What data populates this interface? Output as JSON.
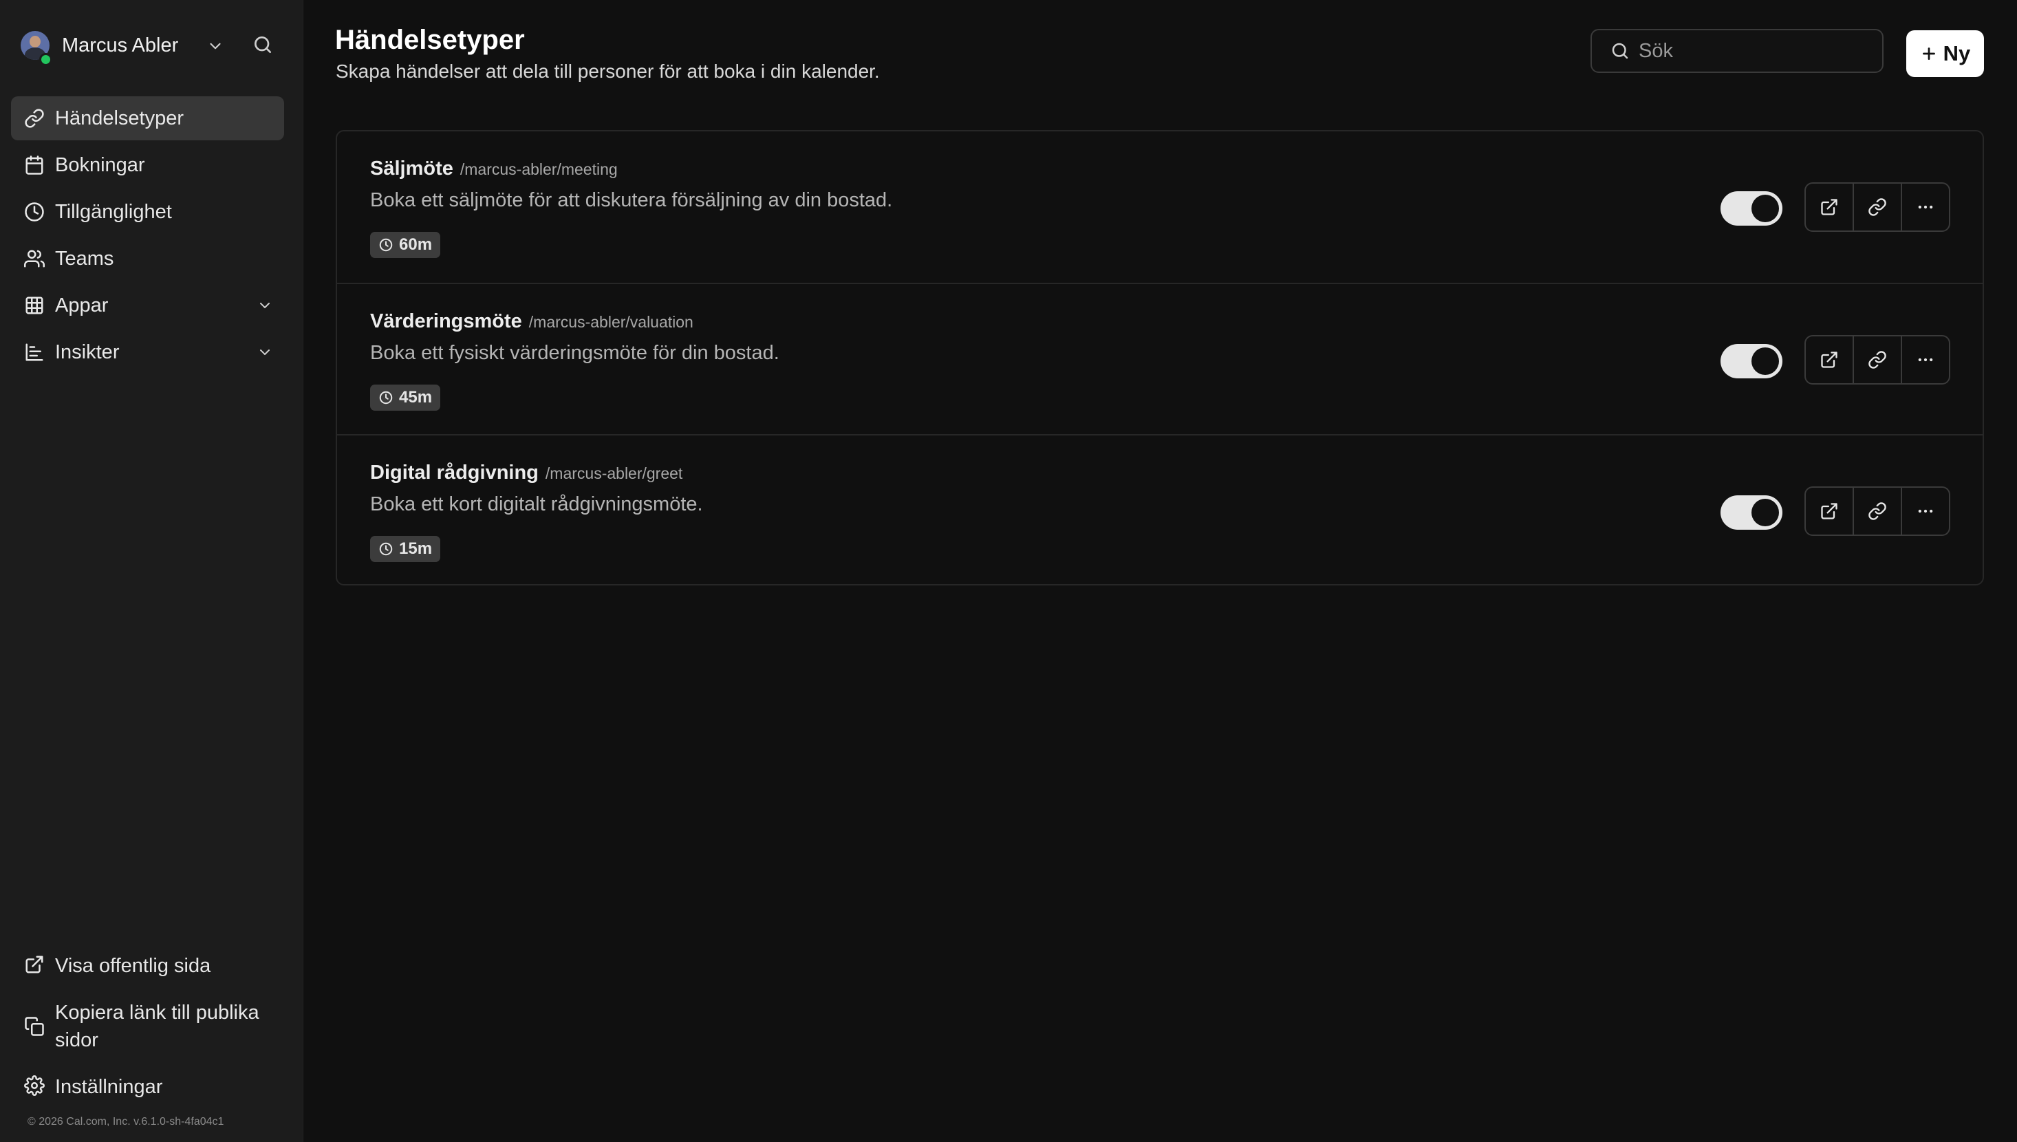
{
  "sidebar": {
    "user": {
      "name": "Marcus Abler"
    },
    "nav": [
      {
        "label": "Händelsetyper",
        "icon": "link-icon",
        "active": true
      },
      {
        "label": "Bokningar",
        "icon": "calendar-icon"
      },
      {
        "label": "Tillgänglighet",
        "icon": "clock-icon"
      },
      {
        "label": "Teams",
        "icon": "users-icon"
      },
      {
        "label": "Appar",
        "icon": "grid-icon",
        "expandable": true
      },
      {
        "label": "Insikter",
        "icon": "bar-chart-icon",
        "expandable": true
      }
    ],
    "bottom": [
      {
        "label": "Visa offentlig sida",
        "icon": "external-link-icon"
      },
      {
        "label": "Kopiera länk till publika sidor",
        "icon": "copy-icon"
      },
      {
        "label": "Inställningar",
        "icon": "gear-icon"
      }
    ],
    "copyright": "© 2026 Cal.com, Inc. v.6.1.0-sh-4fa04c1"
  },
  "header": {
    "title": "Händelsetyper",
    "subtitle": "Skapa händelser att dela till personer för att boka i din kalender.",
    "search_placeholder": "Sök",
    "new_label": "Ny"
  },
  "event_types": [
    {
      "name": "Säljmöte",
      "slug": "/marcus-abler/meeting",
      "description": "Boka ett säljmöte för att diskutera försäljning av din bostad.",
      "duration": "60m",
      "enabled": true
    },
    {
      "name": "Värderingsmöte",
      "slug": "/marcus-abler/valuation",
      "description": "Boka ett fysiskt värderingsmöte för din bostad.",
      "duration": "45m",
      "enabled": true
    },
    {
      "name": "Digital rådgivning",
      "slug": "/marcus-abler/greet",
      "description": "Boka ett kort digitalt rådgivningsmöte.",
      "duration": "15m",
      "enabled": true
    }
  ],
  "colors": {
    "background": "#101010",
    "sidebar": "#1c1c1c",
    "active_nav": "#373737",
    "online_status": "#22c55e"
  }
}
